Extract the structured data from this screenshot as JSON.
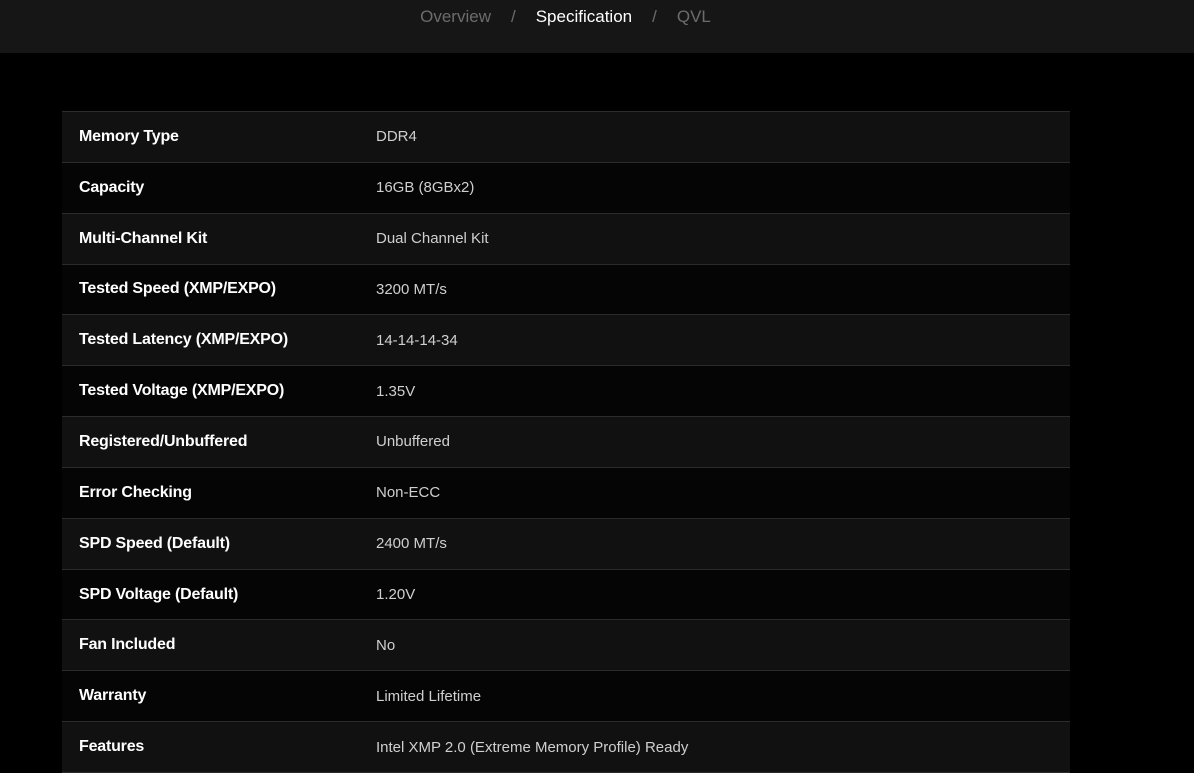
{
  "breadcrumb": {
    "items": [
      {
        "label": "Overview",
        "active": false
      },
      {
        "label": "Specification",
        "active": true
      },
      {
        "label": "QVL",
        "active": false
      }
    ],
    "separator": "/"
  },
  "specs": [
    {
      "label": "Memory Type",
      "value": "DDR4"
    },
    {
      "label": "Capacity",
      "value": "16GB (8GBx2)"
    },
    {
      "label": "Multi-Channel Kit",
      "value": "Dual Channel Kit"
    },
    {
      "label": "Tested Speed (XMP/EXPO)",
      "value": "3200 MT/s"
    },
    {
      "label": "Tested Latency (XMP/EXPO)",
      "value": "14-14-14-34"
    },
    {
      "label": "Tested Voltage (XMP/EXPO)",
      "value": "1.35V"
    },
    {
      "label": "Registered/Unbuffered",
      "value": "Unbuffered"
    },
    {
      "label": "Error Checking",
      "value": "Non-ECC"
    },
    {
      "label": "SPD Speed (Default)",
      "value": "2400 MT/s"
    },
    {
      "label": "SPD Voltage (Default)",
      "value": "1.20V"
    },
    {
      "label": "Fan Included",
      "value": "No"
    },
    {
      "label": "Warranty",
      "value": "Limited Lifetime"
    },
    {
      "label": "Features",
      "value": "Intel XMP 2.0 (Extreme Memory Profile) Ready"
    }
  ],
  "colors": {
    "background": "#000000",
    "nav_background": "#161616",
    "active_text": "#ffffff",
    "inactive_text": "#6c6c6c"
  }
}
